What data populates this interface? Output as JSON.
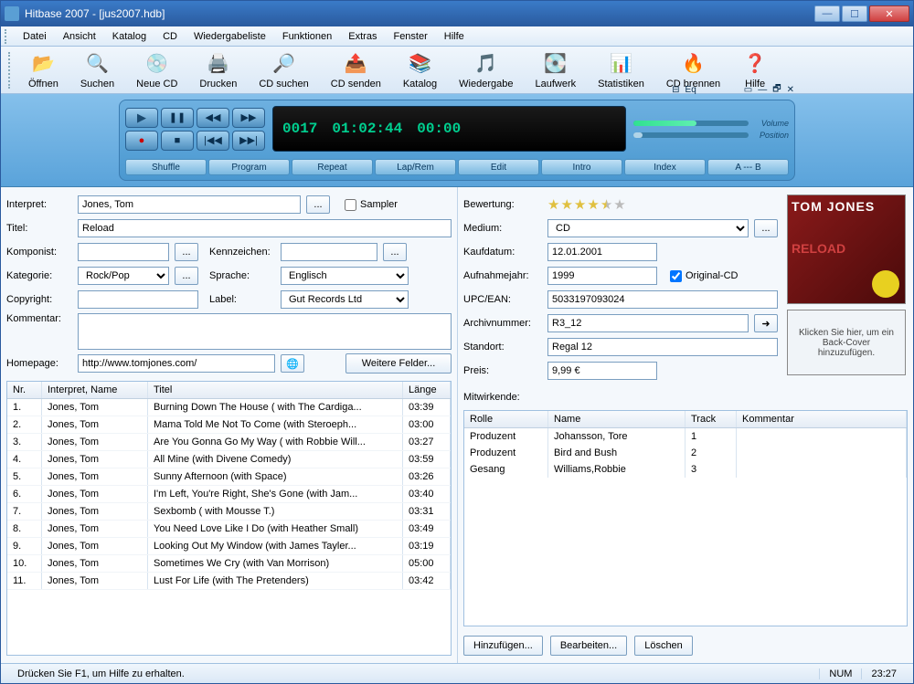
{
  "window": {
    "title": "Hitbase 2007 - [jus2007.hdb]"
  },
  "menu": [
    "Datei",
    "Ansicht",
    "Katalog",
    "CD",
    "Wiedergabeliste",
    "Funktionen",
    "Extras",
    "Fenster",
    "Hilfe"
  ],
  "toolbar": [
    {
      "label": "Öffnen",
      "icon": "📂"
    },
    {
      "label": "Suchen",
      "icon": "🔍"
    },
    {
      "label": "Neue CD",
      "icon": "💿"
    },
    {
      "label": "Drucken",
      "icon": "🖨️"
    },
    {
      "label": "CD suchen",
      "icon": "🔎"
    },
    {
      "label": "CD senden",
      "icon": "📤"
    },
    {
      "label": "Katalog",
      "icon": "📚"
    },
    {
      "label": "Wiedergabe",
      "icon": "🎵"
    },
    {
      "label": "Laufwerk",
      "icon": "💽"
    },
    {
      "label": "Statistiken",
      "icon": "📊"
    },
    {
      "label": "CD brennen",
      "icon": "🔥"
    },
    {
      "label": "Hilfe",
      "icon": "❓"
    }
  ],
  "player": {
    "display_track": "0017",
    "display_time": "01:02:44",
    "display_extra": "00:00",
    "volume_label": "Volume",
    "position_label": "Position",
    "modes": [
      "Shuffle",
      "Program",
      "Repeat",
      "Lap/Rem",
      "Edit",
      "Intro",
      "Index",
      "A --- B"
    ]
  },
  "form": {
    "interpret_label": "Interpret:",
    "interpret": "Jones, Tom",
    "sampler_label": "Sampler",
    "titel_label": "Titel:",
    "titel": "Reload",
    "komponist_label": "Komponist:",
    "komponist": "",
    "kennzeichen_label": "Kennzeichen:",
    "kennzeichen": "",
    "kategorie_label": "Kategorie:",
    "kategorie": "Rock/Pop",
    "sprache_label": "Sprache:",
    "sprache": "Englisch",
    "copyright_label": "Copyright:",
    "copyright": "",
    "label_label": "Label:",
    "label": "Gut Records Ltd",
    "kommentar_label": "Kommentar:",
    "kommentar": "",
    "homepage_label": "Homepage:",
    "homepage": "http://www.tomjones.com/",
    "weitere_felder": "Weitere Felder...",
    "bewertung_label": "Bewertung:",
    "medium_label": "Medium:",
    "medium": "CD",
    "kaufdatum_label": "Kaufdatum:",
    "kaufdatum": "12.01.2001",
    "aufnahmejahr_label": "Aufnahmejahr:",
    "aufnahmejahr": "1999",
    "original_cd_label": "Original-CD",
    "upc_label": "UPC/EAN:",
    "upc": "5033197093024",
    "archiv_label": "Archivnummer:",
    "archiv": "R3_12",
    "standort_label": "Standort:",
    "standort": "Regal 12",
    "preis_label": "Preis:",
    "preis": "9,99 €",
    "mitwirkende_label": "Mitwirkende:"
  },
  "album": {
    "line1": "TOM JONES",
    "line2": "RELOAD",
    "back_placeholder": "Klicken Sie hier, um ein Back-Cover hinzuzufügen."
  },
  "tracks": {
    "cols": {
      "nr": "Nr.",
      "artist": "Interpret, Name",
      "title": "Titel",
      "len": "Länge"
    },
    "rows": [
      {
        "nr": "1.",
        "artist": "Jones, Tom",
        "title": "Burning Down The House ( with The Cardiga...",
        "len": "03:39"
      },
      {
        "nr": "2.",
        "artist": "Jones, Tom",
        "title": "Mama Told Me Not To Come (with Steroeph...",
        "len": "03:00"
      },
      {
        "nr": "3.",
        "artist": "Jones, Tom",
        "title": "Are You Gonna Go My Way ( with Robbie Will...",
        "len": "03:27"
      },
      {
        "nr": "4.",
        "artist": "Jones, Tom",
        "title": "All Mine (with Divene Comedy)",
        "len": "03:59"
      },
      {
        "nr": "5.",
        "artist": "Jones, Tom",
        "title": "Sunny Afternoon (with Space)",
        "len": "03:26"
      },
      {
        "nr": "6.",
        "artist": "Jones, Tom",
        "title": "I'm Left, You're Right, She's Gone (with Jam...",
        "len": "03:40"
      },
      {
        "nr": "7.",
        "artist": "Jones, Tom",
        "title": "Sexbomb ( with Mousse T.)",
        "len": "03:31"
      },
      {
        "nr": "8.",
        "artist": "Jones, Tom",
        "title": "You Need Love Like I Do (with Heather Small)",
        "len": "03:49"
      },
      {
        "nr": "9.",
        "artist": "Jones, Tom",
        "title": "Looking Out My Window (with James Tayler...",
        "len": "03:19"
      },
      {
        "nr": "10.",
        "artist": "Jones, Tom",
        "title": "Sometimes We Cry (with Van Morrison)",
        "len": "05:00"
      },
      {
        "nr": "11.",
        "artist": "Jones, Tom",
        "title": "Lust For Life (with The Pretenders)",
        "len": "03:42"
      }
    ]
  },
  "participants": {
    "cols": {
      "role": "Rolle",
      "name": "Name",
      "track": "Track",
      "comment": "Kommentar"
    },
    "rows": [
      {
        "role": "Produzent",
        "name": "Johansson, Tore",
        "track": "1",
        "comment": ""
      },
      {
        "role": "Produzent",
        "name": "Bird and Bush",
        "track": "2",
        "comment": ""
      },
      {
        "role": "Gesang",
        "name": "Williams,Robbie",
        "track": "3",
        "comment": ""
      }
    ]
  },
  "part_buttons": {
    "add": "Hinzufügen...",
    "edit": "Bearbeiten...",
    "del": "Löschen"
  },
  "status": {
    "help": "Drücken Sie F1, um Hilfe zu erhalten.",
    "num": "NUM",
    "time": "23:27"
  }
}
